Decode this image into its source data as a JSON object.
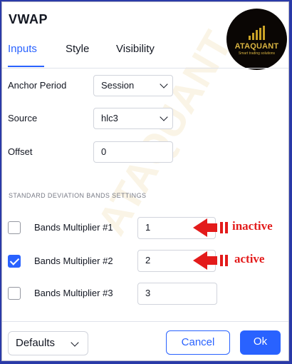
{
  "dialog": {
    "title": "VWAP"
  },
  "logo": {
    "brand": "ATAQUANT",
    "tagline": "Smart trading solutions",
    "watermark": "ATAQUANT"
  },
  "tabs": [
    {
      "label": "Inputs",
      "active": true
    },
    {
      "label": "Style",
      "active": false
    },
    {
      "label": "Visibility",
      "active": false
    }
  ],
  "inputs": {
    "anchor_period": {
      "label": "Anchor Period",
      "value": "Session"
    },
    "source": {
      "label": "Source",
      "value": "hlc3"
    },
    "offset": {
      "label": "Offset",
      "value": "0"
    }
  },
  "bands_section": {
    "heading": "STANDARD DEVIATION BANDS SETTINGS"
  },
  "bands": [
    {
      "label": "Bands Multiplier #1",
      "value": "1",
      "checked": false
    },
    {
      "label": "Bands Multiplier #2",
      "value": "2",
      "checked": true
    },
    {
      "label": "Bands Multiplier #3",
      "value": "3",
      "checked": false
    }
  ],
  "annotations": {
    "inactive": "inactive",
    "active": "active",
    "arrow_color": "#e31b1b"
  },
  "footer": {
    "defaults_label": "Defaults",
    "cancel_label": "Cancel",
    "ok_label": "Ok"
  },
  "colors": {
    "accent": "#2962ff",
    "border_outer": "#2a3aa8"
  }
}
